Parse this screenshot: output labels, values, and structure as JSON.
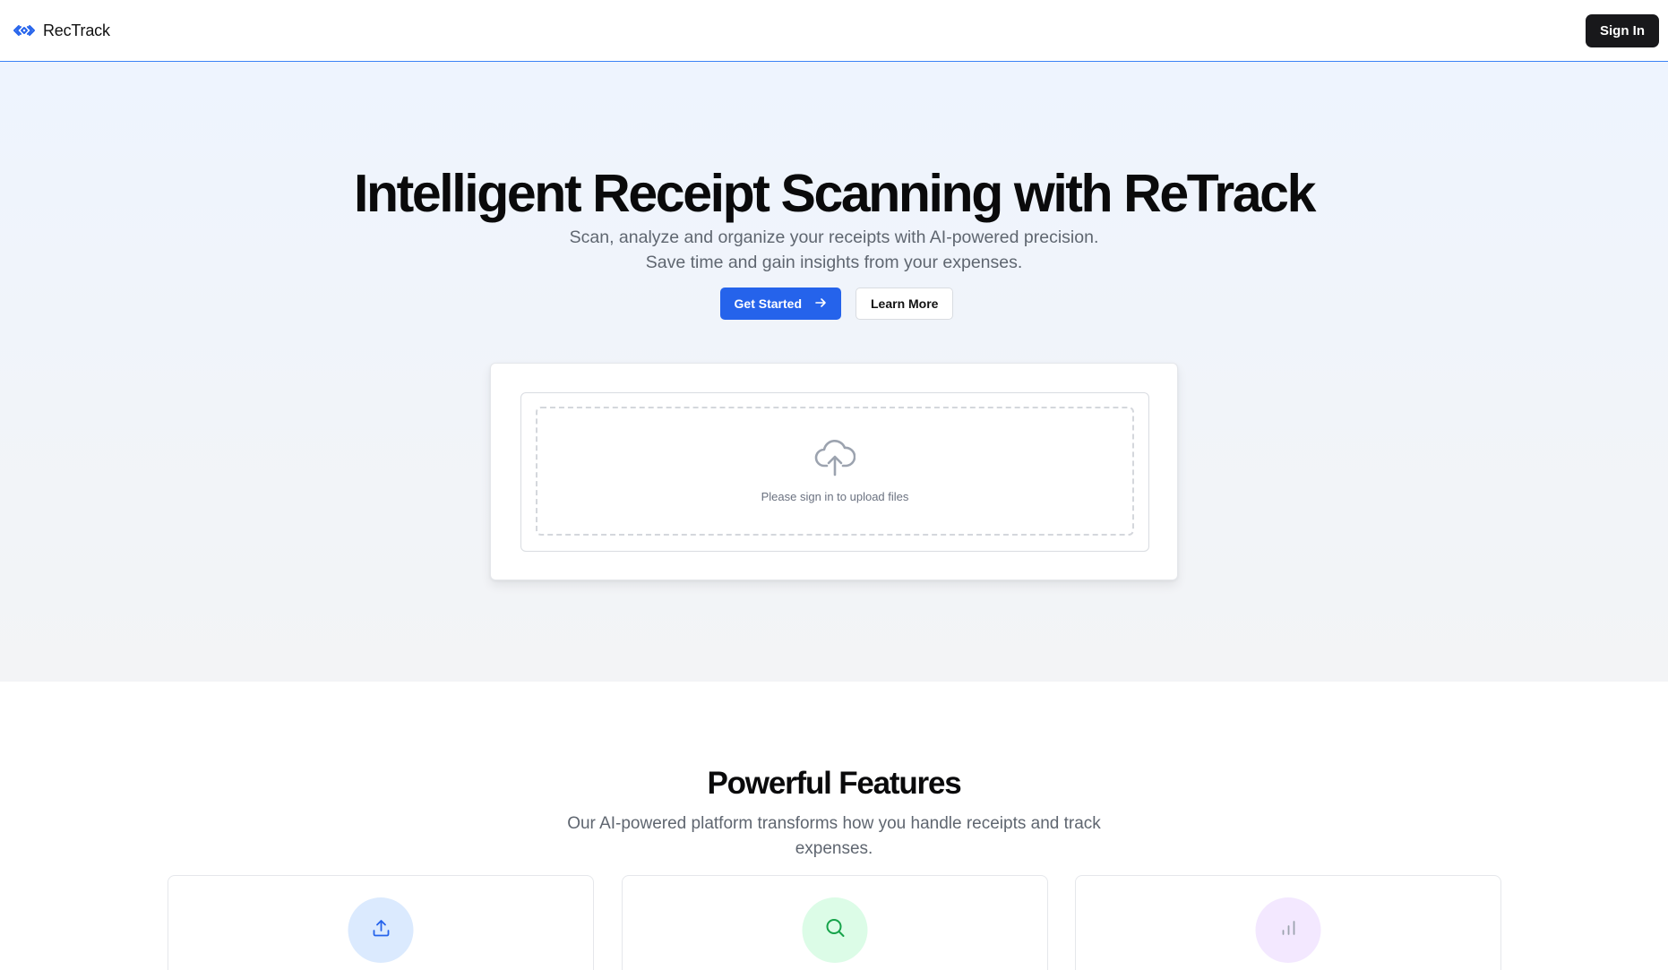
{
  "header": {
    "brand_name": "RecTrack",
    "signin_label": "Sign In"
  },
  "hero": {
    "title": "Intelligent Receipt Scanning with ReTrack",
    "subtitle_line1": "Scan, analyze and organize your receipts with AI-powered precision.",
    "subtitle_line2": "Save time and gain insights from your expenses.",
    "primary_cta": "Get Started",
    "secondary_cta": "Learn More"
  },
  "upload": {
    "message": "Please sign in to upload files",
    "icon": "cloud-upload-icon"
  },
  "features": {
    "title": "Powerful Features",
    "subtitle_line1": "Our AI-powered platform transforms how you handle receipts and track",
    "subtitle_line2": "expenses.",
    "cards": [
      {
        "icon": "upload-icon",
        "icon_bg": "#dbeafe",
        "icon_color": "#2563eb"
      },
      {
        "icon": "search-icon",
        "icon_bg": "#dcfce7",
        "icon_color": "#16a34a"
      },
      {
        "icon": "bar-chart-icon",
        "icon_bg": "#f3e8ff",
        "icon_color": "#9333ea"
      }
    ]
  },
  "colors": {
    "accent": "#2563eb",
    "dark": "#18181b",
    "header_border": "#3b82f6"
  }
}
